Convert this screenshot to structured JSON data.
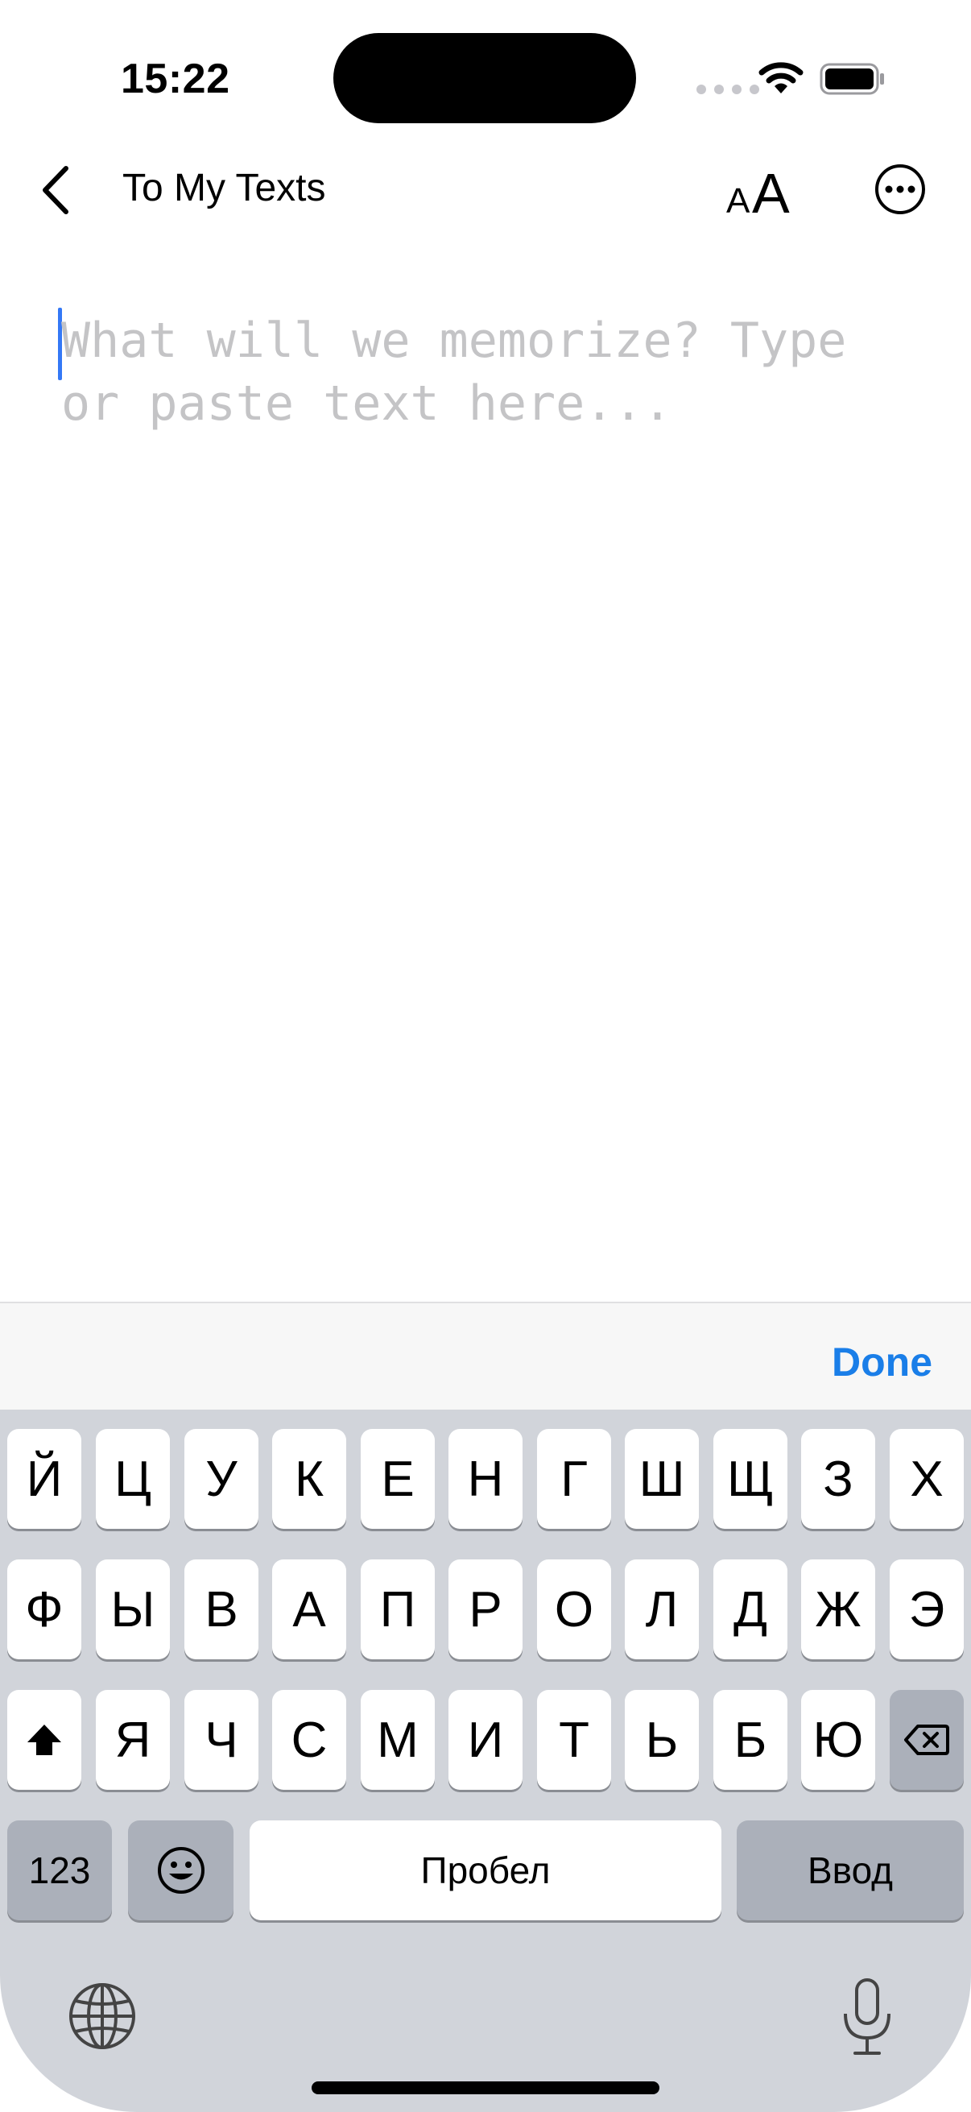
{
  "status_bar": {
    "time": "15:22"
  },
  "nav": {
    "back_label": "To My Texts",
    "text_size_label": "AA"
  },
  "editor": {
    "placeholder": "What will we memorize? Type or paste text here..."
  },
  "accessory": {
    "done_label": "Done"
  },
  "keyboard": {
    "row1": [
      "Й",
      "Ц",
      "У",
      "К",
      "Е",
      "Н",
      "Г",
      "Ш",
      "Щ",
      "З",
      "Х"
    ],
    "row2": [
      "Ф",
      "Ы",
      "В",
      "А",
      "П",
      "Р",
      "О",
      "Л",
      "Д",
      "Ж",
      "Э"
    ],
    "row3": [
      "Я",
      "Ч",
      "С",
      "М",
      "И",
      "Т",
      "Ь",
      "Б",
      "Ю"
    ],
    "numbers_label": "123",
    "space_label": "Пробел",
    "return_label": "Ввод"
  },
  "icons": {
    "back": "chevron-left-icon",
    "text_size": "text-size-icon",
    "more": "ellipsis-circle-icon",
    "shift": "shift-icon",
    "delete": "delete-backward-icon",
    "emoji": "emoji-face-icon",
    "globe": "globe-icon",
    "mic": "microphone-icon"
  },
  "colors": {
    "accent": "#1a7ee8",
    "caret": "#3478f6",
    "placeholder": "#c4c4c6",
    "keyboard_bg": "#d1d4da"
  }
}
